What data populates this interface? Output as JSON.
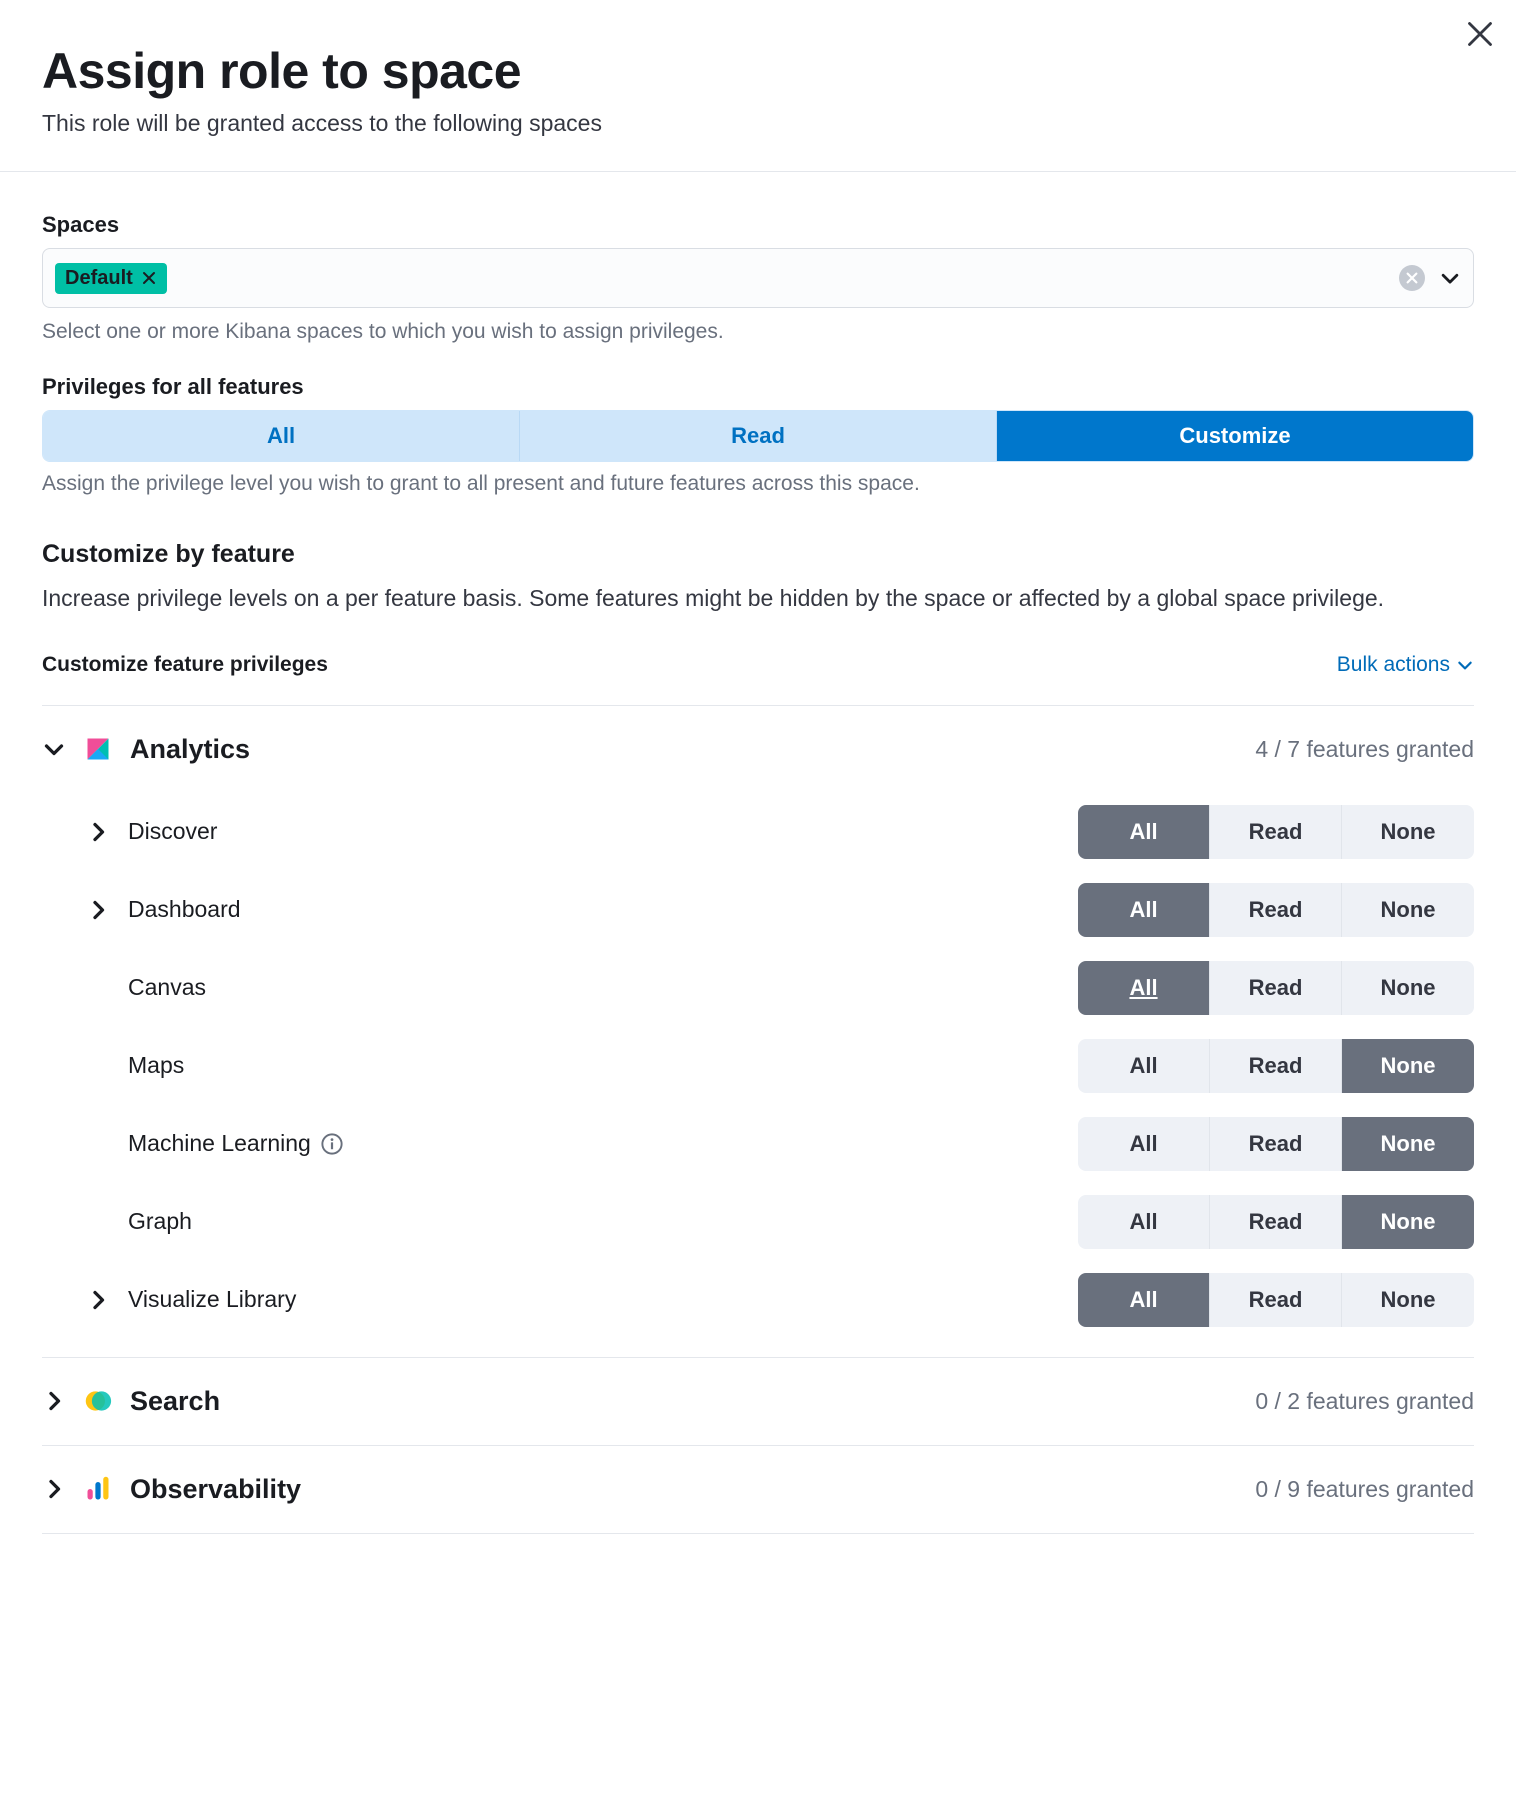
{
  "header": {
    "title": "Assign role to space",
    "subtitle": "This role will be granted access to the following spaces"
  },
  "spaces": {
    "label": "Spaces",
    "selected": [
      {
        "name": "Default"
      }
    ],
    "help": "Select one or more Kibana spaces to which you wish to assign privileges."
  },
  "privileges": {
    "label": "Privileges for all features",
    "options": [
      "All",
      "Read",
      "Customize"
    ],
    "active": 2,
    "help": "Assign the privilege level you wish to grant to all present and future features across this space."
  },
  "customize": {
    "title": "Customize by feature",
    "desc": "Increase privilege levels on a per feature basis. Some features might be hidden by the space or affected by a global space privilege."
  },
  "featurePrivs": {
    "label": "Customize feature privileges",
    "bulk": "Bulk actions",
    "optionLabels": [
      "All",
      "Read",
      "None"
    ],
    "categories": [
      {
        "name": "Analytics",
        "icon": "analytics",
        "count": "4 / 7 features granted",
        "expanded": true,
        "features": [
          {
            "name": "Discover",
            "hasSub": true,
            "active": 0,
            "underline": false
          },
          {
            "name": "Dashboard",
            "hasSub": true,
            "active": 0,
            "underline": false
          },
          {
            "name": "Canvas",
            "hasSub": false,
            "active": 0,
            "underline": true
          },
          {
            "name": "Maps",
            "hasSub": false,
            "active": 2,
            "underline": false
          },
          {
            "name": "Machine Learning",
            "hasSub": false,
            "info": true,
            "active": 2,
            "underline": false
          },
          {
            "name": "Graph",
            "hasSub": false,
            "active": 2,
            "underline": false
          },
          {
            "name": "Visualize Library",
            "hasSub": true,
            "active": 0,
            "underline": false
          }
        ]
      },
      {
        "name": "Search",
        "icon": "search",
        "count": "0 / 2 features granted",
        "expanded": false
      },
      {
        "name": "Observability",
        "icon": "observability",
        "count": "0 / 9 features granted",
        "expanded": false
      }
    ]
  }
}
